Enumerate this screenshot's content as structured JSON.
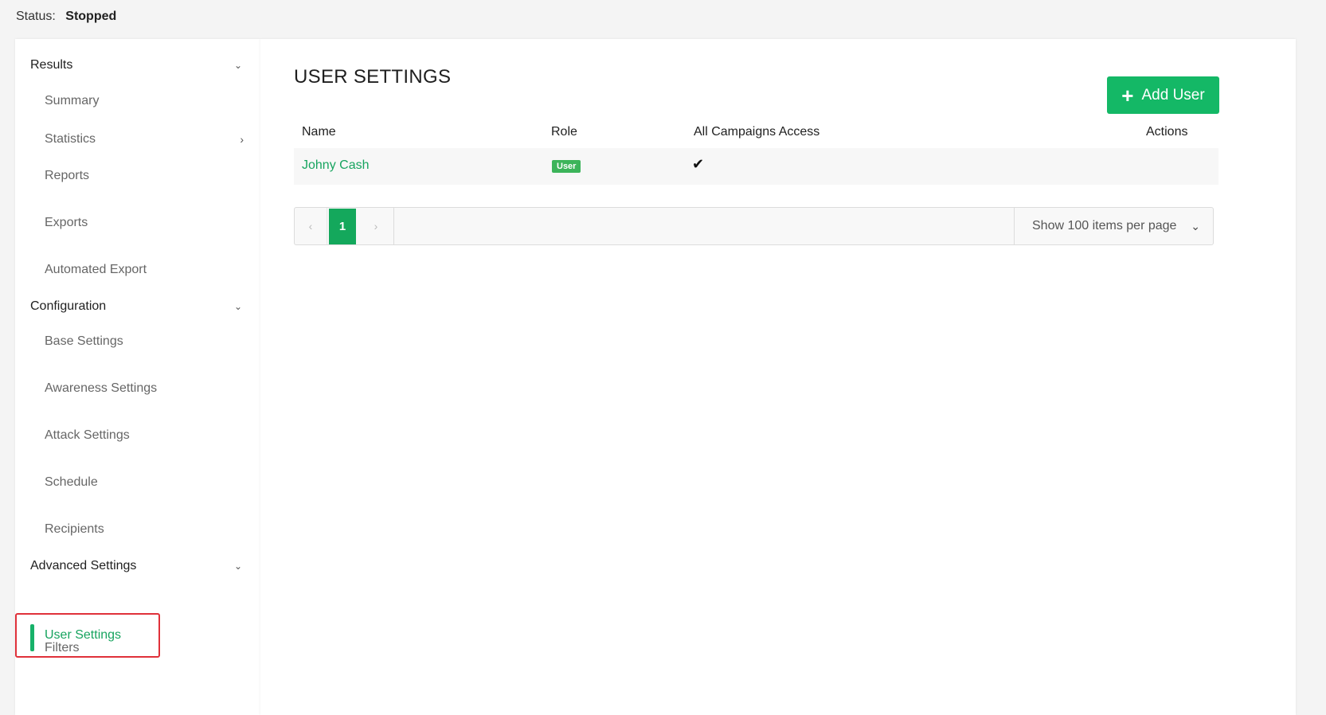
{
  "status": {
    "label": "Status:",
    "value": "Stopped"
  },
  "sidebar": {
    "results": {
      "header": "Results",
      "items": [
        "Summary",
        "Statistics",
        "Reports",
        "Exports",
        "Automated Export"
      ]
    },
    "configuration": {
      "header": "Configuration",
      "items": [
        "Base Settings",
        "Awareness Settings",
        "Attack Settings",
        "Schedule",
        "Recipients"
      ]
    },
    "advanced": {
      "header": "Advanced Settings",
      "items": [
        "User Settings",
        "Filters"
      ]
    }
  },
  "main": {
    "title": "USER SETTINGS",
    "add_button": "Add User",
    "columns": [
      "Name",
      "Role",
      "All Campaigns Access",
      "Actions"
    ],
    "rows": [
      {
        "name": "Johny Cash",
        "role": "User",
        "all_campaigns_access": "✔"
      }
    ],
    "pagination": {
      "current_page": "1",
      "per_page_label": "Show 100 items per page"
    }
  },
  "colors": {
    "accent": "#14b866",
    "active_outline": "#e0313a"
  },
  "icons": [
    "chevron-down-icon",
    "chevron-right-icon",
    "plus-icon",
    "check-icon",
    "chevron-left-icon"
  ]
}
